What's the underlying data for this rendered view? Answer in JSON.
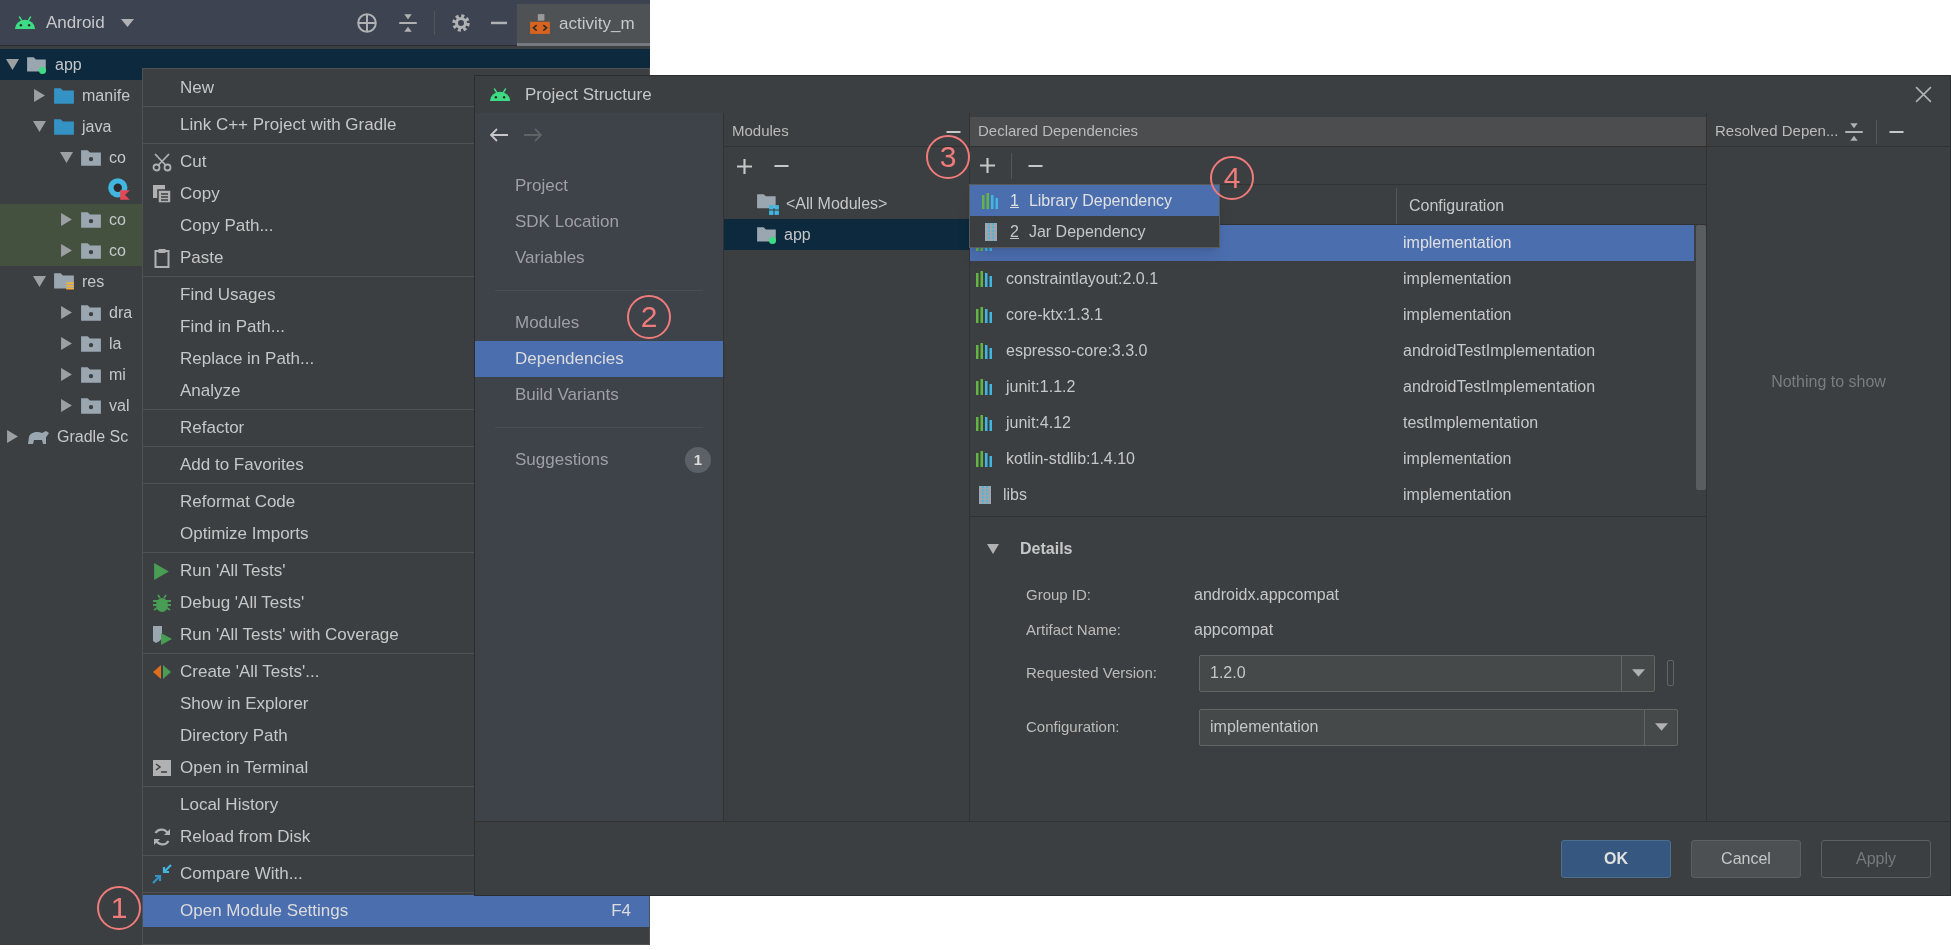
{
  "project_panel": {
    "view_selector": "Android",
    "editor_tab": "activity_m",
    "tree": [
      {
        "kind": "module",
        "label": "app",
        "expanded": true,
        "selected": true,
        "highlighted": false,
        "children": [
          {
            "kind": "source",
            "label": "manife",
            "expanded": false,
            "selected": false,
            "highlighted": false
          },
          {
            "kind": "source",
            "label": "java",
            "expanded": true,
            "selected": false,
            "highlighted": false,
            "children": [
              {
                "kind": "package",
                "label": "co",
                "expanded": true,
                "selected": false,
                "highlighted": false,
                "children": [
                  {
                    "kind": "kotlin_file",
                    "selected": false,
                    "highlighted": false
                  }
                ]
              },
              {
                "kind": "package",
                "label": "co",
                "expanded": false,
                "selected": false,
                "highlighted": true
              },
              {
                "kind": "package",
                "label": "co",
                "expanded": false,
                "selected": false,
                "highlighted": true
              }
            ]
          },
          {
            "kind": "resources",
            "label": "res",
            "expanded": true,
            "selected": false,
            "highlighted": false,
            "children": [
              {
                "kind": "package",
                "label": "dra",
                "expanded": false,
                "selected": false,
                "highlighted": false
              },
              {
                "kind": "package",
                "label": "la",
                "expanded": false,
                "selected": false,
                "highlighted": false
              },
              {
                "kind": "package",
                "label": "mi",
                "expanded": false,
                "selected": false,
                "highlighted": false
              },
              {
                "kind": "package",
                "label": "val",
                "expanded": false,
                "selected": false,
                "highlighted": false
              }
            ]
          }
        ]
      },
      {
        "kind": "gradle",
        "label": "Gradle Sc",
        "expanded": false,
        "selected": false,
        "highlighted": false
      }
    ]
  },
  "context_menu": {
    "groups": [
      [
        {
          "kind": "plain",
          "label": "New",
          "selected": false
        }
      ],
      [
        {
          "kind": "plain",
          "label": "Link C++ Project with Gradle",
          "selected": false
        }
      ],
      [
        {
          "kind": "cut",
          "label": "Cut",
          "selected": false
        },
        {
          "kind": "copy",
          "label": "Copy",
          "selected": false
        },
        {
          "kind": "plain",
          "label": "Copy Path...",
          "selected": false
        },
        {
          "kind": "paste",
          "label": "Paste",
          "selected": false
        }
      ],
      [
        {
          "kind": "plain",
          "label": "Find Usages",
          "selected": false
        },
        {
          "kind": "plain",
          "label": "Find in Path...",
          "selected": false
        },
        {
          "kind": "plain",
          "label": "Replace in Path...",
          "selected": false
        },
        {
          "kind": "plain",
          "label": "Analyze",
          "selected": false
        }
      ],
      [
        {
          "kind": "plain",
          "label": "Refactor",
          "selected": false
        }
      ],
      [
        {
          "kind": "plain",
          "label": "Add to Favorites",
          "selected": false
        }
      ],
      [
        {
          "kind": "plain",
          "label": "Reformat Code",
          "selected": false
        },
        {
          "kind": "plain",
          "label": "Optimize Imports",
          "selected": false
        }
      ],
      [
        {
          "kind": "run",
          "label": "Run 'All Tests'",
          "selected": false
        },
        {
          "kind": "debug",
          "label": "Debug 'All Tests'",
          "selected": false
        },
        {
          "kind": "coverage",
          "label": "Run 'All Tests' with Coverage",
          "selected": false
        }
      ],
      [
        {
          "kind": "create",
          "label": "Create 'All Tests'...",
          "selected": false
        },
        {
          "kind": "plain",
          "label": "Show in Explorer",
          "selected": false
        },
        {
          "kind": "plain",
          "label": "Directory Path",
          "selected": false
        },
        {
          "kind": "terminal",
          "label": "Open in Terminal",
          "selected": false
        }
      ],
      [
        {
          "kind": "plain",
          "label": "Local History",
          "selected": false
        },
        {
          "kind": "reload",
          "label": "Reload from Disk",
          "selected": false
        }
      ],
      [
        {
          "kind": "compare",
          "label": "Compare With...",
          "selected": false
        }
      ],
      [
        {
          "kind": "plain",
          "label": "Open Module Settings",
          "shortcut": "F4",
          "selected": true
        }
      ]
    ]
  },
  "dialog": {
    "title": "Project Structure",
    "nav": {
      "groups": [
        [
          {
            "label": "Project",
            "selected": false
          },
          {
            "label": "SDK Location",
            "selected": false
          },
          {
            "label": "Variables",
            "selected": false
          }
        ],
        [
          {
            "label": "Modules",
            "selected": false
          },
          {
            "label": "Dependencies",
            "selected": true
          },
          {
            "label": "Build Variants",
            "selected": false
          }
        ],
        [
          {
            "label": "Suggestions",
            "badge": "1",
            "selected": false
          }
        ]
      ]
    },
    "modules": {
      "title": "Modules",
      "items": [
        {
          "kind": "all",
          "label": "<All Modules>",
          "selected": false
        },
        {
          "kind": "module",
          "label": "app",
          "selected": true
        }
      ]
    },
    "declared": {
      "title": "Declared Dependencies",
      "add_menu": [
        {
          "kind": "library",
          "number": "1",
          "label": "Library Dependency",
          "selected": true
        },
        {
          "kind": "jar",
          "number": "2",
          "label": "Jar Dependency",
          "selected": false
        }
      ],
      "columns": [
        "Configuration"
      ],
      "rows": [
        {
          "kind": "library",
          "configuration": "implementation",
          "selected": true
        },
        {
          "kind": "library",
          "name": "constraintlayout:2.0.1",
          "configuration": "implementation",
          "selected": false
        },
        {
          "kind": "library",
          "name": "core-ktx:1.3.1",
          "configuration": "implementation",
          "selected": false
        },
        {
          "kind": "library",
          "name": "espresso-core:3.3.0",
          "configuration": "androidTestImplementation",
          "selected": false
        },
        {
          "kind": "library",
          "name": "junit:1.1.2",
          "configuration": "androidTestImplementation",
          "selected": false
        },
        {
          "kind": "library",
          "name": "junit:4.12",
          "configuration": "testImplementation",
          "selected": false
        },
        {
          "kind": "library",
          "name": "kotlin-stdlib:1.4.10",
          "configuration": "implementation",
          "selected": false
        },
        {
          "kind": "jar",
          "name": "libs",
          "configuration": "implementation",
          "selected": false
        }
      ],
      "details": {
        "title": "Details",
        "expanded": true,
        "fields": [
          {
            "kind": "text",
            "label": "Group ID:",
            "value": "androidx.appcompat"
          },
          {
            "kind": "text",
            "label": "Artifact Name:",
            "value": "appcompat"
          },
          {
            "kind": "editable_combo",
            "label": "Requested Version:",
            "value": "1.2.0"
          },
          {
            "kind": "combo",
            "label": "Configuration:",
            "value": "implementation"
          }
        ]
      }
    },
    "resolved": {
      "title": "Resolved Depen...",
      "empty_text": "Nothing to show"
    },
    "buttons": [
      {
        "kind": "default",
        "label": "OK",
        "disabled": false
      },
      {
        "kind": "normal",
        "label": "Cancel",
        "disabled": false
      },
      {
        "kind": "normal",
        "label": "Apply",
        "disabled": true
      }
    ]
  },
  "annotations": [
    {
      "label": "1"
    },
    {
      "label": "2"
    },
    {
      "label": "3"
    },
    {
      "label": "4"
    }
  ]
}
